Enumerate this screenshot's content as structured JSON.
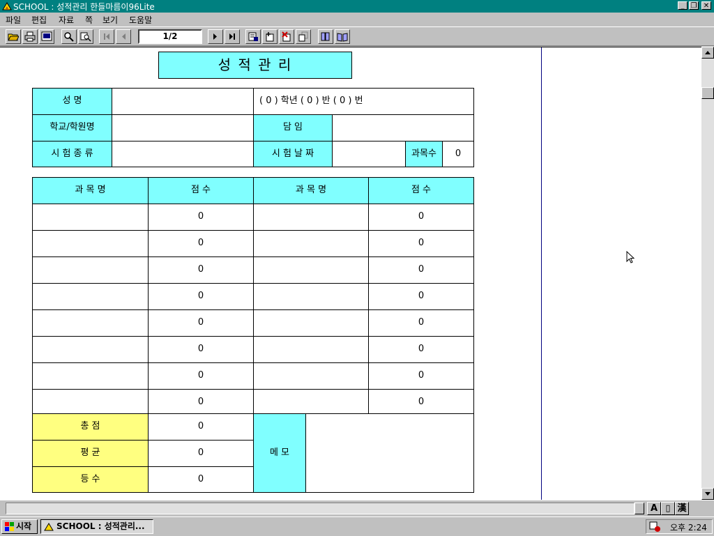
{
  "window": {
    "title": "SCHOOL : 성적관리   한들마름이96Lite",
    "minimize": "_",
    "restore": "❐",
    "close": "✕"
  },
  "menu": [
    "파일",
    "편집",
    "자료",
    "쪽",
    "보기",
    "도움말"
  ],
  "toolbar": {
    "page_indicator": "1/2",
    "icons": [
      "open-folder-icon",
      "print-icon",
      "preview-icon",
      "zoom-icon",
      "search-icon",
      "first-page-icon",
      "previous-page-icon",
      "next-page-icon",
      "last-page-icon",
      "record-edit-icon",
      "record-add-icon",
      "record-delete-icon",
      "record-copy-icon",
      "book-icon",
      "book-open-icon"
    ]
  },
  "form": {
    "title": "성  적  관  리",
    "info": {
      "name_label": "성       명",
      "name_value": "",
      "grade_text": "(  0  ) 학년    (   0   ) 반    (   0  ) 번",
      "school_label": "학교/학원명",
      "school_value": "",
      "teacher_label": "담       임",
      "teacher_value": "",
      "exam_type_label": "시 험 종 류",
      "exam_type_value": "",
      "exam_date_label": "시 험 날 짜",
      "exam_date_value": "",
      "subject_count_label": "과목수",
      "subject_count_value": "0"
    },
    "grade_table": {
      "headers": [
        "과 목 명",
        "점       수",
        "과 목 명",
        "점       수"
      ],
      "rows": [
        {
          "subject1": "",
          "score1": "0",
          "subject2": "",
          "score2": "0"
        },
        {
          "subject1": "",
          "score1": "0",
          "subject2": "",
          "score2": "0"
        },
        {
          "subject1": "",
          "score1": "0",
          "subject2": "",
          "score2": "0"
        },
        {
          "subject1": "",
          "score1": "0",
          "subject2": "",
          "score2": "0"
        },
        {
          "subject1": "",
          "score1": "0",
          "subject2": "",
          "score2": "0"
        },
        {
          "subject1": "",
          "score1": "0",
          "subject2": "",
          "score2": "0"
        },
        {
          "subject1": "",
          "score1": "0",
          "subject2": "",
          "score2": "0"
        },
        {
          "subject1": "",
          "score1": "0",
          "subject2": "",
          "score2": "0"
        }
      ]
    },
    "summary": {
      "total_label": "총          점",
      "total_value": "0",
      "average_label": "평          균",
      "average_value": "0",
      "rank_label": "등          수",
      "rank_value": "0",
      "memo_label": "메  모",
      "memo_value": ""
    }
  },
  "statusbar": {
    "mode_buttons": [
      "A",
      "▯",
      "漢"
    ]
  },
  "taskbar": {
    "start_label": "시작",
    "task_label": "SCHOOL : 성적관리...",
    "clock": "오후 2:24"
  },
  "colors": {
    "titlebar": "#008080",
    "label_cyan": "#80ffff",
    "label_yellow": "#ffff80",
    "page_border": "#00007f"
  }
}
